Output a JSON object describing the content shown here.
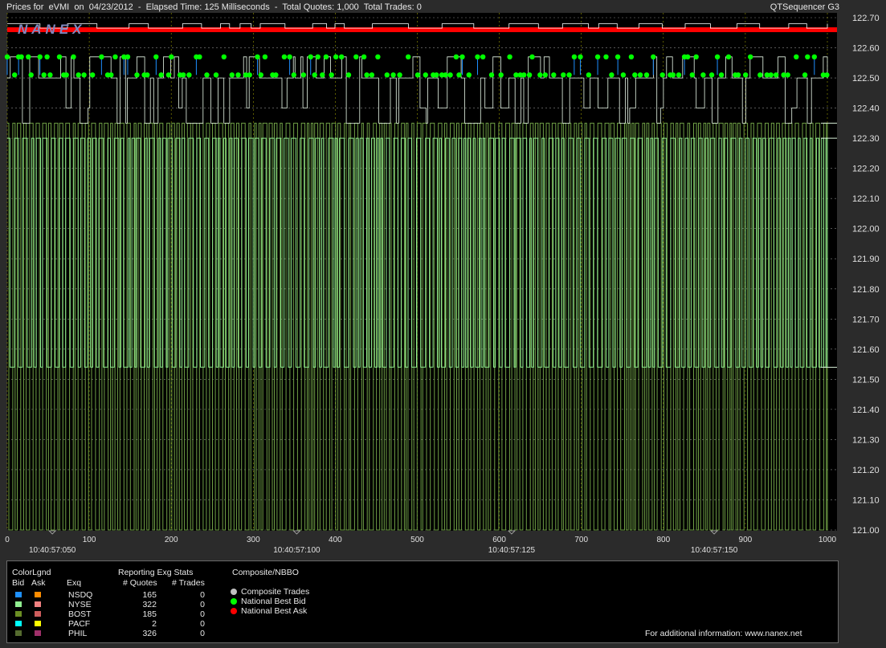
{
  "header": {
    "left": "Prices for  eVMI  on  04/23/2012  -  Elapsed Time: 125 Milliseconds  -  Total Quotes: 1,000  Total Trades: 0",
    "right": "QTSequencer G3"
  },
  "logo": {
    "text": "NANEX"
  },
  "chart_data": {
    "type": "line",
    "title": "Prices for  eVMI  on  04/23/2012  -  Elapsed Time: 125 Milliseconds  -  Total Quotes: 1,000  Total Trades: 0",
    "xlim": [
      0,
      1000
    ],
    "ylim": [
      121.0,
      122.7
    ],
    "y_ticks": [
      "122.70",
      "122.60",
      "122.50",
      "122.40",
      "122.30",
      "122.20",
      "122.10",
      "122.00",
      "121.90",
      "121.80",
      "121.70",
      "121.60",
      "121.50",
      "121.40",
      "121.30",
      "121.20",
      "121.10",
      "121.00"
    ],
    "x_ticks": [
      "0",
      "100",
      "200",
      "300",
      "400",
      "500",
      "600",
      "700",
      "800",
      "900",
      "1000"
    ],
    "x_tick_values": [
      0,
      100,
      200,
      300,
      400,
      500,
      600,
      700,
      800,
      900,
      1000
    ],
    "time_labels": [
      {
        "x": 55,
        "label": "10:40:57:050"
      },
      {
        "x": 353,
        "label": "10:40:57:100"
      },
      {
        "x": 615,
        "label": "10:40:57:125"
      },
      {
        "x": 862,
        "label": "10:40:57:150"
      }
    ],
    "grid": true,
    "series": [
      {
        "name": "National Best Ask",
        "color": "#ff0000",
        "level": 122.66
      },
      {
        "name": "National Best Bid",
        "color": "#00ff00",
        "levels": [
          122.57,
          122.51
        ]
      },
      {
        "name": "BOST",
        "color": "#90ee90",
        "low": 121.0,
        "high": 122.35
      },
      {
        "name": "NYSE",
        "color": "#b0ffb0",
        "low": 121.54,
        "high": 122.3
      }
    ]
  },
  "legend": {
    "colorlgnd": "ColorLgnd",
    "bid": "Bid",
    "ask": "Ask",
    "exq": "Exq",
    "stats_title": "Reporting Exg Stats",
    "quotes_hdr": "# Quotes",
    "trades_hdr": "# Trades",
    "rows": [
      {
        "exq": "NSDQ",
        "quotes": "165",
        "trades": "0",
        "bid_color": "#1e90ff",
        "ask_color": "#ff8c00"
      },
      {
        "exq": "NYSE",
        "quotes": "322",
        "trades": "0",
        "bid_color": "#90ee90",
        "ask_color": "#f08080"
      },
      {
        "exq": "BOST",
        "quotes": "185",
        "trades": "0",
        "bid_color": "#6b8e23",
        "ask_color": "#cd5c5c"
      },
      {
        "exq": "PACF",
        "quotes": "2",
        "trades": "0",
        "bid_color": "#00ffff",
        "ask_color": "#ffff00"
      },
      {
        "exq": "PHIL",
        "quotes": "326",
        "trades": "0",
        "bid_color": "#556b2f",
        "ask_color": "#a0306a"
      }
    ],
    "composite_title": "Composite/NBBO",
    "composite": [
      {
        "label": "Composite Trades",
        "color": "#c0c0c0"
      },
      {
        "label": "National Best Bid",
        "color": "#00ff00"
      },
      {
        "label": "National Best Ask",
        "color": "#ff0000"
      }
    ],
    "footer": "For additional information: www.nanex.net"
  }
}
